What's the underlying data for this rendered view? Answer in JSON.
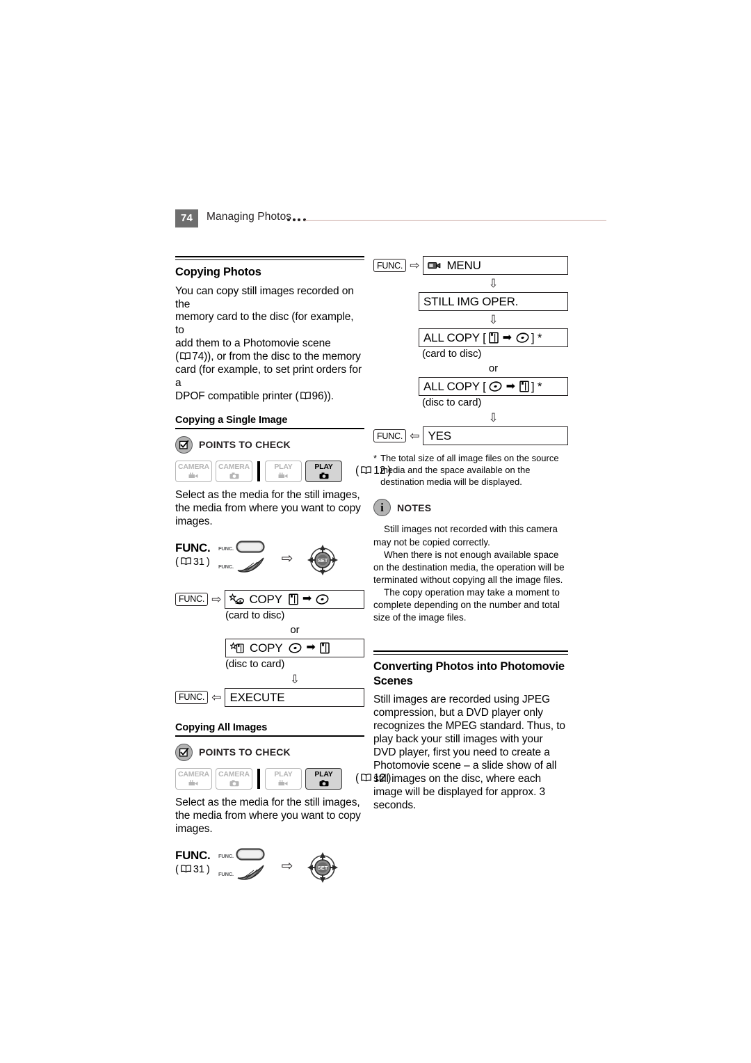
{
  "header": {
    "page_number": "74",
    "title": "Managing Photos",
    "dot_count": 4
  },
  "left_column": {
    "section_title": "Copying Photos",
    "intro_paragraph": "You can copy still images recorded on the memory card to the disc (for example, to add them to a Photomovie scene ( 74)), or from the disc to the memory card (for example, to set print orders for a DPOF compatible printer ( 96)).",
    "intro_lines": [
      "You can copy still images recorded on the",
      "memory card to the disc (for example, to",
      "add them to a Photomovie scene",
      "( 74)), or from the disc to the memory",
      "card (for example, to set print orders for a",
      "DPOF compatible printer ( 96))."
    ],
    "sub_single": {
      "title": "Copying a Single Image",
      "points_to_check_label": "POINTS TO CHECK",
      "points_icon": "checkbox-check-icon",
      "modes": [
        {
          "label": "CAMERA",
          "icon": "movie-camera-icon",
          "active": false
        },
        {
          "label": "CAMERA",
          "icon": "still-camera-icon",
          "active": false
        },
        {
          "label": "PLAY",
          "icon": "movie-camera-icon",
          "active": false
        },
        {
          "label": "PLAY",
          "icon": "still-camera-icon",
          "active": true
        }
      ],
      "mode_pageref": "12",
      "instruction": "Select as the media for the still images, the media from where you want to copy images.",
      "func_step": {
        "label": "FUNC.",
        "pageref": "31",
        "button_tag": "FUNC.",
        "lever_tag": "FUNC.",
        "arrow": "right-arrow-icon",
        "joystick_label": "SET"
      },
      "flow": {
        "func_key_1": "FUNC.",
        "row1_text": "COPY",
        "row1_icon_left": "star-card-icon",
        "row1_from": "card-icon",
        "row1_to": "disc-icon",
        "row1_caption": "(card to disc)",
        "or_label": "or",
        "row2_text": "COPY",
        "row2_icon_left": "star-disc-icon",
        "row2_from": "disc-icon",
        "row2_to": "card-icon",
        "row2_caption": "(disc to card)",
        "func_key_2": "FUNC.",
        "execute_text": "EXECUTE"
      }
    },
    "sub_all": {
      "title": "Copying All Images",
      "points_to_check_label": "POINTS TO CHECK",
      "points_icon": "checkbox-check-icon",
      "modes": [
        {
          "label": "CAMERA",
          "icon": "movie-camera-icon",
          "active": false
        },
        {
          "label": "CAMERA",
          "icon": "still-camera-icon",
          "active": false
        },
        {
          "label": "PLAY",
          "icon": "movie-camera-icon",
          "active": false
        },
        {
          "label": "PLAY",
          "icon": "still-camera-icon",
          "active": true
        }
      ],
      "mode_pageref": "12",
      "instruction": "Select as the media for the still images, the media from where you want to copy images.",
      "func_step": {
        "label": "FUNC.",
        "pageref": "31",
        "button_tag": "FUNC.",
        "lever_tag": "FUNC.",
        "arrow": "right-arrow-icon",
        "joystick_label": "SET"
      }
    }
  },
  "right_column": {
    "flow": {
      "func_key_1": "FUNC.",
      "menu_text": "MENU",
      "menu_icon": "camcorder-menu-icon",
      "still_img_oper": "STILL IMG OPER.",
      "all_copy_1_prefix": "ALL COPY [",
      "all_copy_1_suffix": "] *",
      "all_copy_1_from": "card-icon",
      "all_copy_1_to": "disc-icon",
      "all_copy_1_caption": "(card to disc)",
      "or_label": "or",
      "all_copy_2_prefix": "ALL COPY [",
      "all_copy_2_suffix": "] *",
      "all_copy_2_from": "disc-icon",
      "all_copy_2_to": "card-icon",
      "all_copy_2_caption": "(disc to card)",
      "func_key_2": "FUNC.",
      "yes_text": "YES"
    },
    "footnote": {
      "marker": "*",
      "text": "The total size of all image files on the source media and the space available on the destination media will be displayed."
    },
    "notes": {
      "label": "NOTES",
      "icon": "info-circle-icon",
      "items": [
        "Still images not recorded with this camera may not be copied correctly.",
        "When there is not enough available space on the destination media, the operation will be terminated without copying all the image files.",
        "The copy operation may take a moment to complete depending on the number and total size of the image files."
      ]
    },
    "converting": {
      "title": "Converting Photos into Photomovie Scenes",
      "paragraph": "Still images are recorded using JPEG compression, but a DVD player only recognizes the MPEG standard. Thus, to play back your still images with your DVD player, first you need to create a Photomovie scene – a slide show of all still images on the disc, where each image will be displayed for approx. 3 seconds."
    }
  },
  "colors": {
    "page_num_bg": "#6e6e6e",
    "header_rule": "#c9a9a4",
    "text": "#000000",
    "mode_inactive": "#b5b5b5",
    "mode_active_bg": "#d4d4d4",
    "callout_circle": "#b3b3b3"
  }
}
